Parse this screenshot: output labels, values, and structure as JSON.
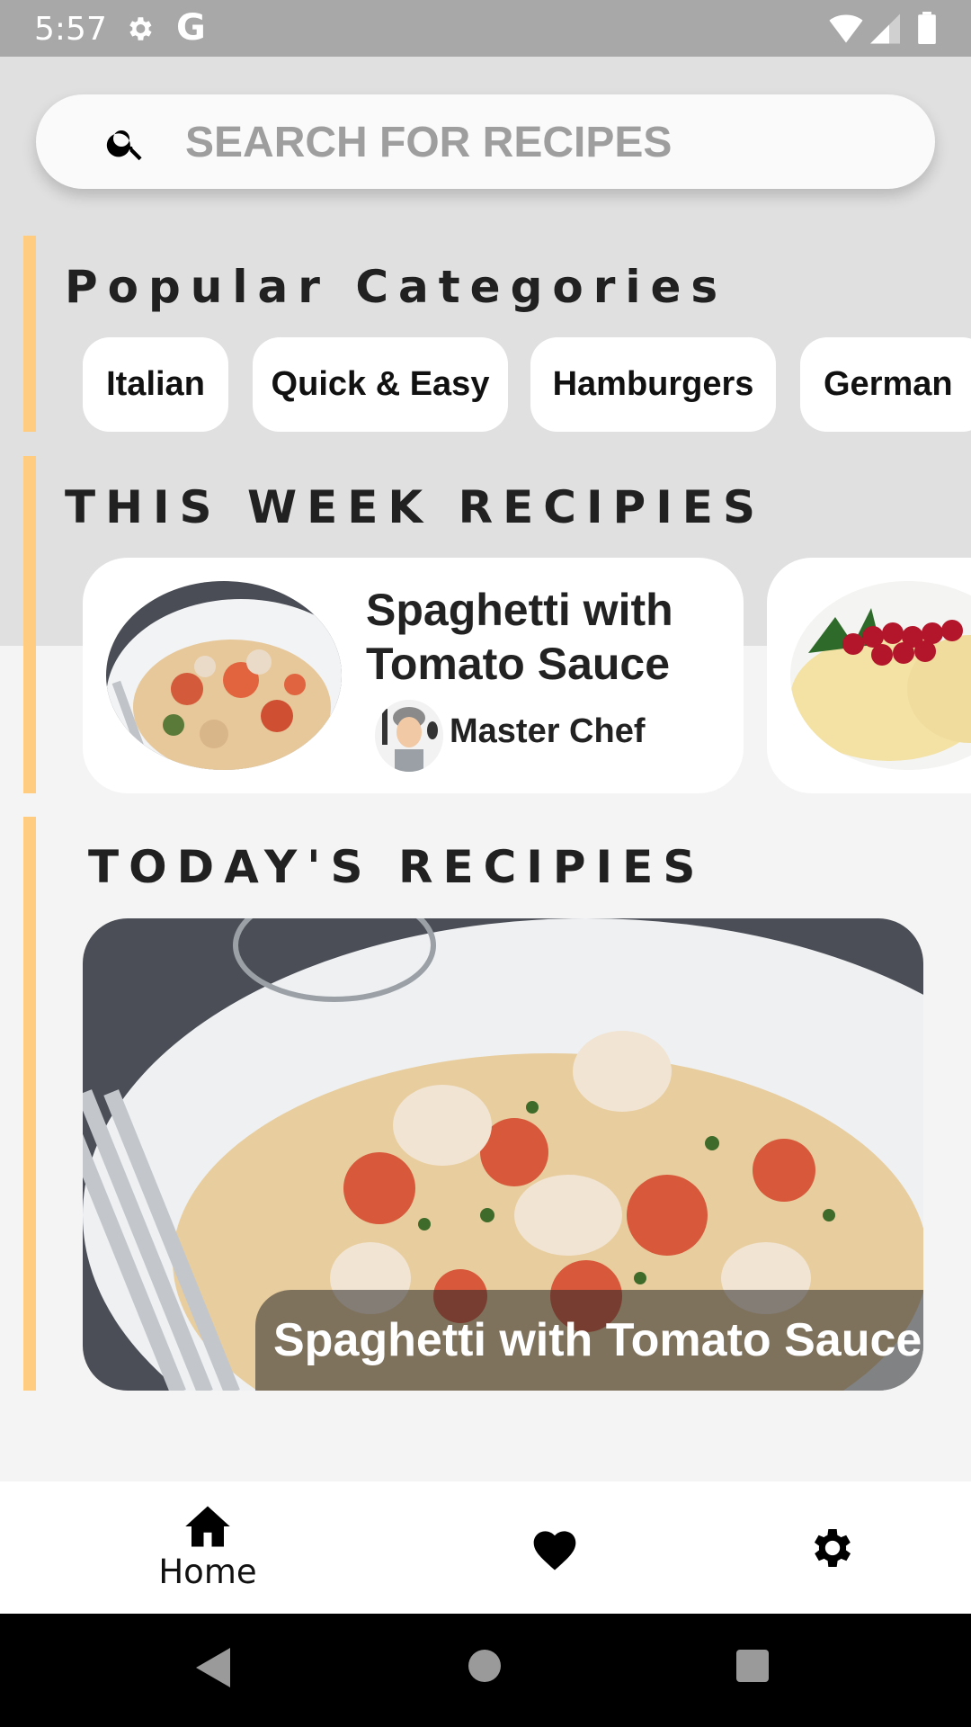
{
  "status_bar": {
    "time": "5:57",
    "icons": [
      "settings-icon",
      "google-icon",
      "wifi-icon",
      "signal-icon",
      "battery-icon"
    ],
    "google_letter": "G"
  },
  "search": {
    "placeholder": "SEARCH FOR RECIPES",
    "value": "",
    "icon": "search-icon"
  },
  "colors": {
    "accent": "#ffcc80",
    "top_background": "#e0e0e0",
    "page_background": "#f4f4f4",
    "card_background": "#ffffff",
    "text": "#212121"
  },
  "popular_categories": {
    "title": "Popular Categories",
    "chips": [
      {
        "label": "Italian"
      },
      {
        "label": "Quick & Easy"
      },
      {
        "label": "Hamburgers"
      },
      {
        "label": "German"
      }
    ]
  },
  "this_week": {
    "title": "THIS WEEK RECIPIES",
    "cards": [
      {
        "title": "Spaghetti with Tomato Sauce",
        "chef": "Master Chef",
        "image": "spaghetti-clams-photo"
      },
      {
        "title": "",
        "chef": "",
        "image": "cheese-dish-with-redcurrants-photo"
      }
    ]
  },
  "today": {
    "title": "TODAY'S RECIPIES",
    "recipe": {
      "title": "Spaghetti with Tomato Sauce",
      "image": "spaghetti-clams-photo"
    }
  },
  "bottom_nav": {
    "items": [
      {
        "label": "Home",
        "icon": "home-icon",
        "active": true
      },
      {
        "label": "",
        "icon": "heart-icon",
        "active": false
      },
      {
        "label": "",
        "icon": "settings-icon",
        "active": false
      }
    ]
  },
  "system_nav": {
    "buttons": [
      "back",
      "home",
      "recents"
    ]
  }
}
